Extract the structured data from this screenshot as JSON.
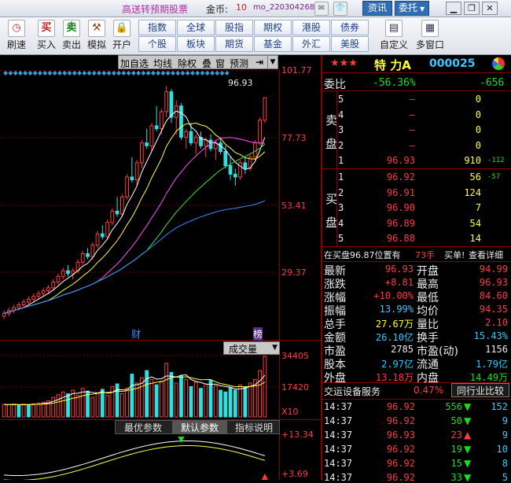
{
  "titlebar": {
    "app_title": "高送转预期股票",
    "coin_label": "金币:",
    "coin_value": "10",
    "username": "mo_220304268",
    "btn_news": "资讯",
    "btn_trust": "委托"
  },
  "toolbar": {
    "left_buttons": [
      {
        "label": "刷速",
        "icon": "clock-icon"
      },
      {
        "label": "买入",
        "icon": "buy-icon",
        "glyph": "买"
      },
      {
        "label": "卖出",
        "icon": "sell-icon",
        "glyph": "卖"
      },
      {
        "label": "模拟",
        "icon": "gavel-icon"
      },
      {
        "label": "开户",
        "icon": "lock-icon"
      }
    ],
    "grid_row1": [
      "指数",
      "全球",
      "股指",
      "期权",
      "港股",
      "债券"
    ],
    "grid_row2": [
      "个股",
      "板块",
      "期货",
      "基金",
      "外汇",
      "美股"
    ],
    "right_buttons": [
      {
        "label": "自定义"
      },
      {
        "label": "多窗口"
      }
    ]
  },
  "chart": {
    "toolbar": [
      "加自选",
      "均线",
      "除权",
      "叠",
      "窗",
      "预测"
    ],
    "price_axis": [
      "101.77",
      "77.73",
      "53.41",
      "29.37"
    ],
    "last_price_tag": "96.93",
    "event_labels": [
      "财",
      "榜"
    ],
    "volume_header": "成交量",
    "volume_axis": [
      "34405",
      "17420",
      "X10"
    ],
    "tabs": [
      "最优参数",
      "默认参数",
      "指标说明"
    ],
    "indicator_axis": [
      "+13.34",
      "+3.69"
    ]
  },
  "chart_data": {
    "type": "candlestick",
    "ylim": [
      15,
      105
    ],
    "candles": [
      [
        20,
        22,
        19,
        21
      ],
      [
        21,
        23,
        20,
        22
      ],
      [
        22,
        24,
        21,
        23
      ],
      [
        23,
        25,
        22,
        24
      ],
      [
        24,
        26,
        23,
        25
      ],
      [
        25,
        27,
        24,
        26
      ],
      [
        26,
        28,
        25,
        27
      ],
      [
        27,
        29,
        26,
        28
      ],
      [
        28,
        30,
        27,
        29
      ],
      [
        29,
        31,
        28,
        30
      ],
      [
        30,
        33,
        29,
        32
      ],
      [
        32,
        35,
        31,
        34
      ],
      [
        34,
        37,
        33,
        36
      ],
      [
        36,
        38,
        34,
        35
      ],
      [
        35,
        37,
        33,
        36
      ],
      [
        36,
        40,
        35,
        39
      ],
      [
        39,
        43,
        38,
        42
      ],
      [
        42,
        44,
        40,
        41
      ],
      [
        41,
        46,
        40,
        45
      ],
      [
        45,
        50,
        44,
        49
      ],
      [
        49,
        52,
        47,
        48
      ],
      [
        48,
        54,
        47,
        53
      ],
      [
        53,
        58,
        52,
        57
      ],
      [
        57,
        62,
        55,
        56
      ],
      [
        56,
        63,
        55,
        62
      ],
      [
        62,
        70,
        61,
        69
      ],
      [
        69,
        76,
        67,
        68
      ],
      [
        68,
        75,
        66,
        74
      ],
      [
        74,
        82,
        72,
        81
      ],
      [
        81,
        86,
        79,
        80
      ],
      [
        80,
        88,
        78,
        87
      ],
      [
        87,
        94,
        85,
        86
      ],
      [
        86,
        93,
        84,
        92
      ],
      [
        92,
        101,
        90,
        99
      ],
      [
        99,
        100,
        88,
        90
      ],
      [
        90,
        96,
        84,
        94
      ],
      [
        94,
        95,
        82,
        83
      ],
      [
        83,
        86,
        79,
        85
      ],
      [
        85,
        88,
        80,
        81
      ],
      [
        81,
        84,
        77,
        83
      ],
      [
        83,
        85,
        79,
        80
      ],
      [
        80,
        83,
        76,
        82
      ],
      [
        82,
        84,
        78,
        79
      ],
      [
        79,
        82,
        75,
        81
      ],
      [
        81,
        83,
        77,
        78
      ],
      [
        78,
        80,
        72,
        73
      ],
      [
        73,
        76,
        68,
        70
      ],
      [
        70,
        72,
        66,
        69
      ],
      [
        69,
        75,
        68,
        74
      ],
      [
        74,
        76,
        70,
        72
      ],
      [
        72,
        77,
        71,
        76
      ],
      [
        76,
        82,
        75,
        81
      ],
      [
        81,
        90,
        80,
        89
      ],
      [
        89,
        96.93,
        88,
        96.93
      ]
    ],
    "volume": [
      7000,
      6800,
      7200,
      6500,
      7100,
      6900,
      7400,
      7800,
      8200,
      9000,
      11000,
      12500,
      14000,
      13000,
      15000,
      12000,
      16000,
      14500,
      11000,
      13500,
      15500,
      12000,
      17000,
      18500,
      13000,
      16000,
      24000,
      19000,
      22000,
      26000,
      21000,
      18000,
      20000,
      30000,
      25000,
      19000,
      23000,
      21000,
      17000,
      19500,
      16000,
      18500,
      20500,
      17500,
      15000,
      14000,
      16500,
      15000,
      18000,
      17000,
      19000,
      21000,
      26000,
      34000
    ],
    "volume_up": [
      1,
      1,
      1,
      0,
      1,
      0,
      1,
      1,
      1,
      1,
      1,
      1,
      1,
      0,
      1,
      1,
      1,
      0,
      1,
      1,
      0,
      1,
      1,
      0,
      1,
      1,
      0,
      1,
      1,
      0,
      1,
      0,
      1,
      1,
      0,
      1,
      0,
      1,
      0,
      1,
      0,
      1,
      0,
      1,
      0,
      0,
      0,
      0,
      1,
      0,
      1,
      1,
      1,
      1
    ]
  },
  "quote": {
    "stars": "★★★",
    "name": "特 力A",
    "code": "000025",
    "weibi_label": "委比",
    "weibi_pct": "-56.36%",
    "weibi_val": "-656",
    "sell_label": "卖盘",
    "buy_label": "买盘",
    "sells": [
      {
        "lvl": "5",
        "price": "–",
        "vol": "0",
        "chg": ""
      },
      {
        "lvl": "4",
        "price": "–",
        "vol": "0",
        "chg": ""
      },
      {
        "lvl": "3",
        "price": "–",
        "vol": "0",
        "chg": ""
      },
      {
        "lvl": "2",
        "price": "–",
        "vol": "0",
        "chg": ""
      },
      {
        "lvl": "1",
        "price": "96.93",
        "vol": "910",
        "chg": "-112"
      }
    ],
    "buys": [
      {
        "lvl": "1",
        "price": "96.92",
        "vol": "56",
        "chg": "-57"
      },
      {
        "lvl": "2",
        "price": "96.91",
        "vol": "124",
        "chg": ""
      },
      {
        "lvl": "3",
        "price": "96.90",
        "vol": "7",
        "chg": ""
      },
      {
        "lvl": "4",
        "price": "96.89",
        "vol": "54",
        "chg": ""
      },
      {
        "lvl": "5",
        "price": "96.88",
        "vol": "14",
        "chg": ""
      }
    ],
    "buy_info": "在买盘96.87位置有",
    "buy_info_vol": "73手",
    "buy_info_tail": "买单!",
    "buy_info_link": "查看详细",
    "stats": [
      [
        "最新",
        "96.93",
        "开盘",
        "94.99"
      ],
      [
        "涨跌",
        "+8.81",
        "最高",
        "96.93"
      ],
      [
        "涨幅",
        "+10.00%",
        "最低",
        "84.60"
      ],
      [
        "振幅",
        "13.99%",
        "均价",
        "94.35"
      ],
      [
        "总手",
        "27.67万",
        "量比",
        "2.10"
      ],
      [
        "金额",
        "26.10亿",
        "换手",
        "15.43%"
      ],
      [
        "市盈",
        "2785",
        "市盈(动)",
        "1156"
      ],
      [
        "股本",
        "2.97亿",
        "流通",
        "1.79亿"
      ],
      [
        "外盘",
        "13.18万",
        "内盘",
        "14.49万"
      ]
    ],
    "sector": "交运设备服务",
    "sector_pct": "0.47%",
    "sector_btn": "同行业比较",
    "ticks": [
      {
        "time": "14:37",
        "price": "96.92",
        "vol": "556",
        "dir": "down",
        "n": "152"
      },
      {
        "time": "14:37",
        "price": "96.92",
        "vol": "50",
        "dir": "down",
        "n": "9"
      },
      {
        "time": "14:37",
        "price": "96.93",
        "vol": "23",
        "dir": "up",
        "n": "9"
      },
      {
        "time": "14:37",
        "price": "96.92",
        "vol": "19",
        "dir": "down",
        "n": "10"
      },
      {
        "time": "14:37",
        "price": "96.92",
        "vol": "15",
        "dir": "down",
        "n": "8"
      },
      {
        "time": "14:37",
        "price": "96.92",
        "vol": "33",
        "dir": "down",
        "n": "5"
      }
    ]
  }
}
